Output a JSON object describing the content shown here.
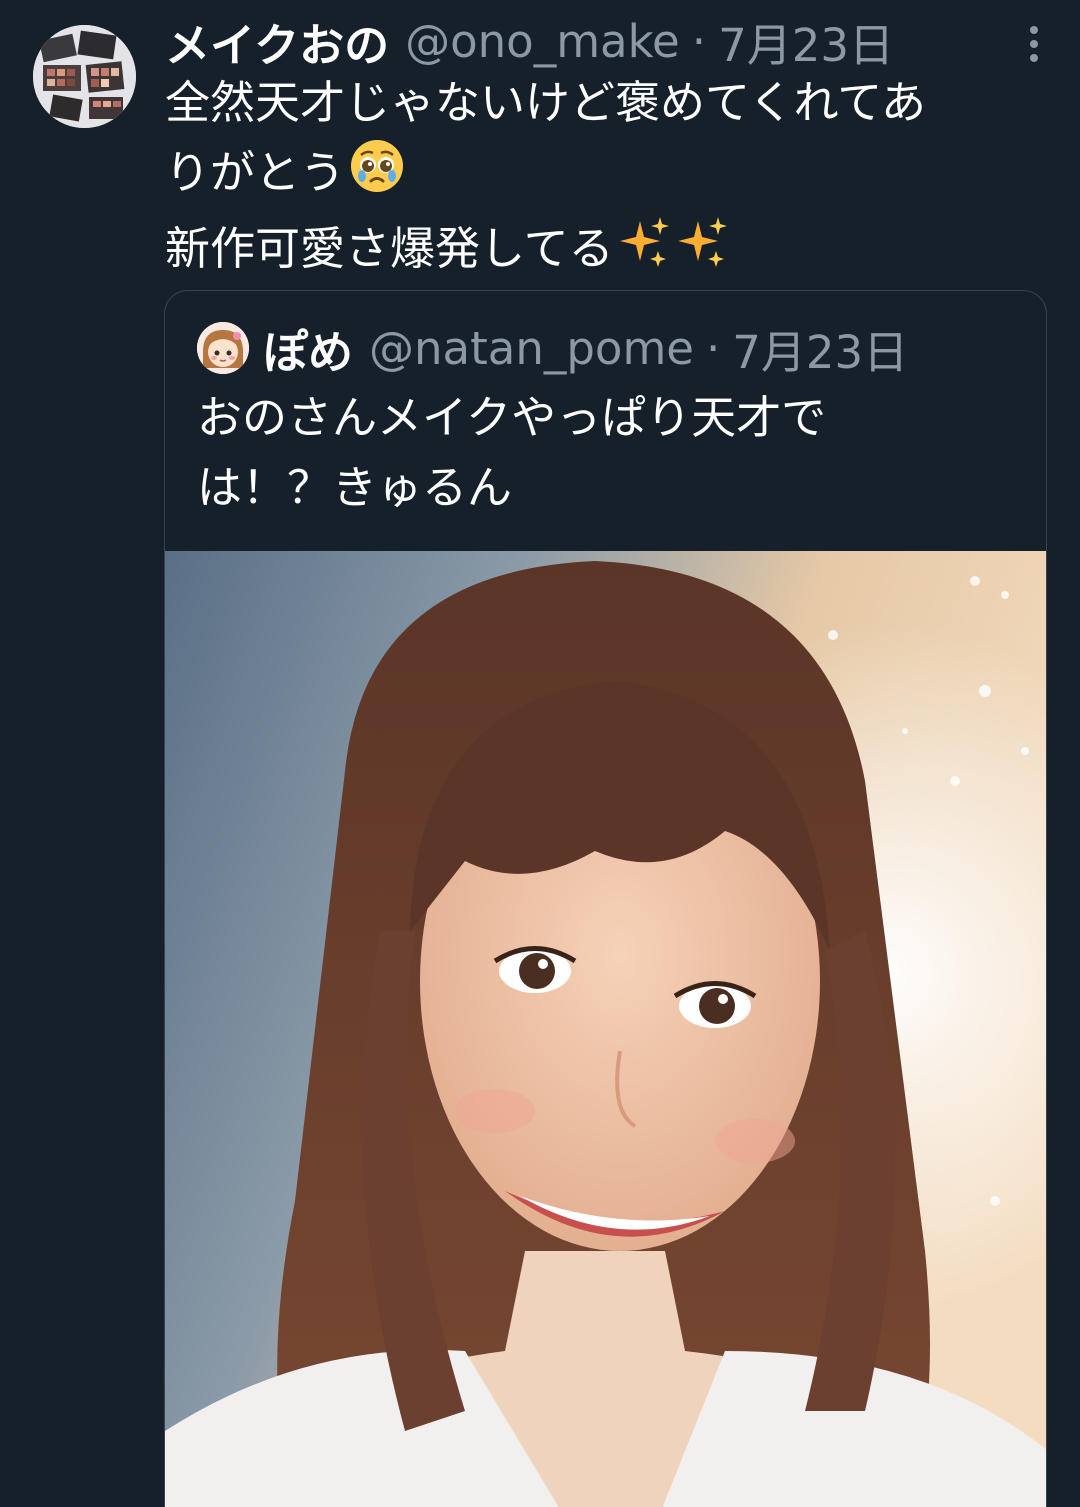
{
  "tweet": {
    "display_name": "メイクおの",
    "handle": "@ono_make",
    "separator": "·",
    "date": "7月23日",
    "text_lines": [
      "全然天才じゃないけど褒めてくれてあ",
      "りがとう",
      "新作可愛さ爆発してる"
    ],
    "emojis": [
      "pleading-face",
      "sparkles",
      "sparkles"
    ]
  },
  "quoted_tweet": {
    "display_name": "ぽめ",
    "handle": "@natan_pome",
    "separator": "·",
    "date": "7月23日",
    "text_lines": [
      "おのさんメイクやっぱり天才で",
      "は！？きゅるん"
    ]
  },
  "colors": {
    "background": "#15202b",
    "secondary_text": "#8b98a5",
    "border": "#38444d"
  }
}
